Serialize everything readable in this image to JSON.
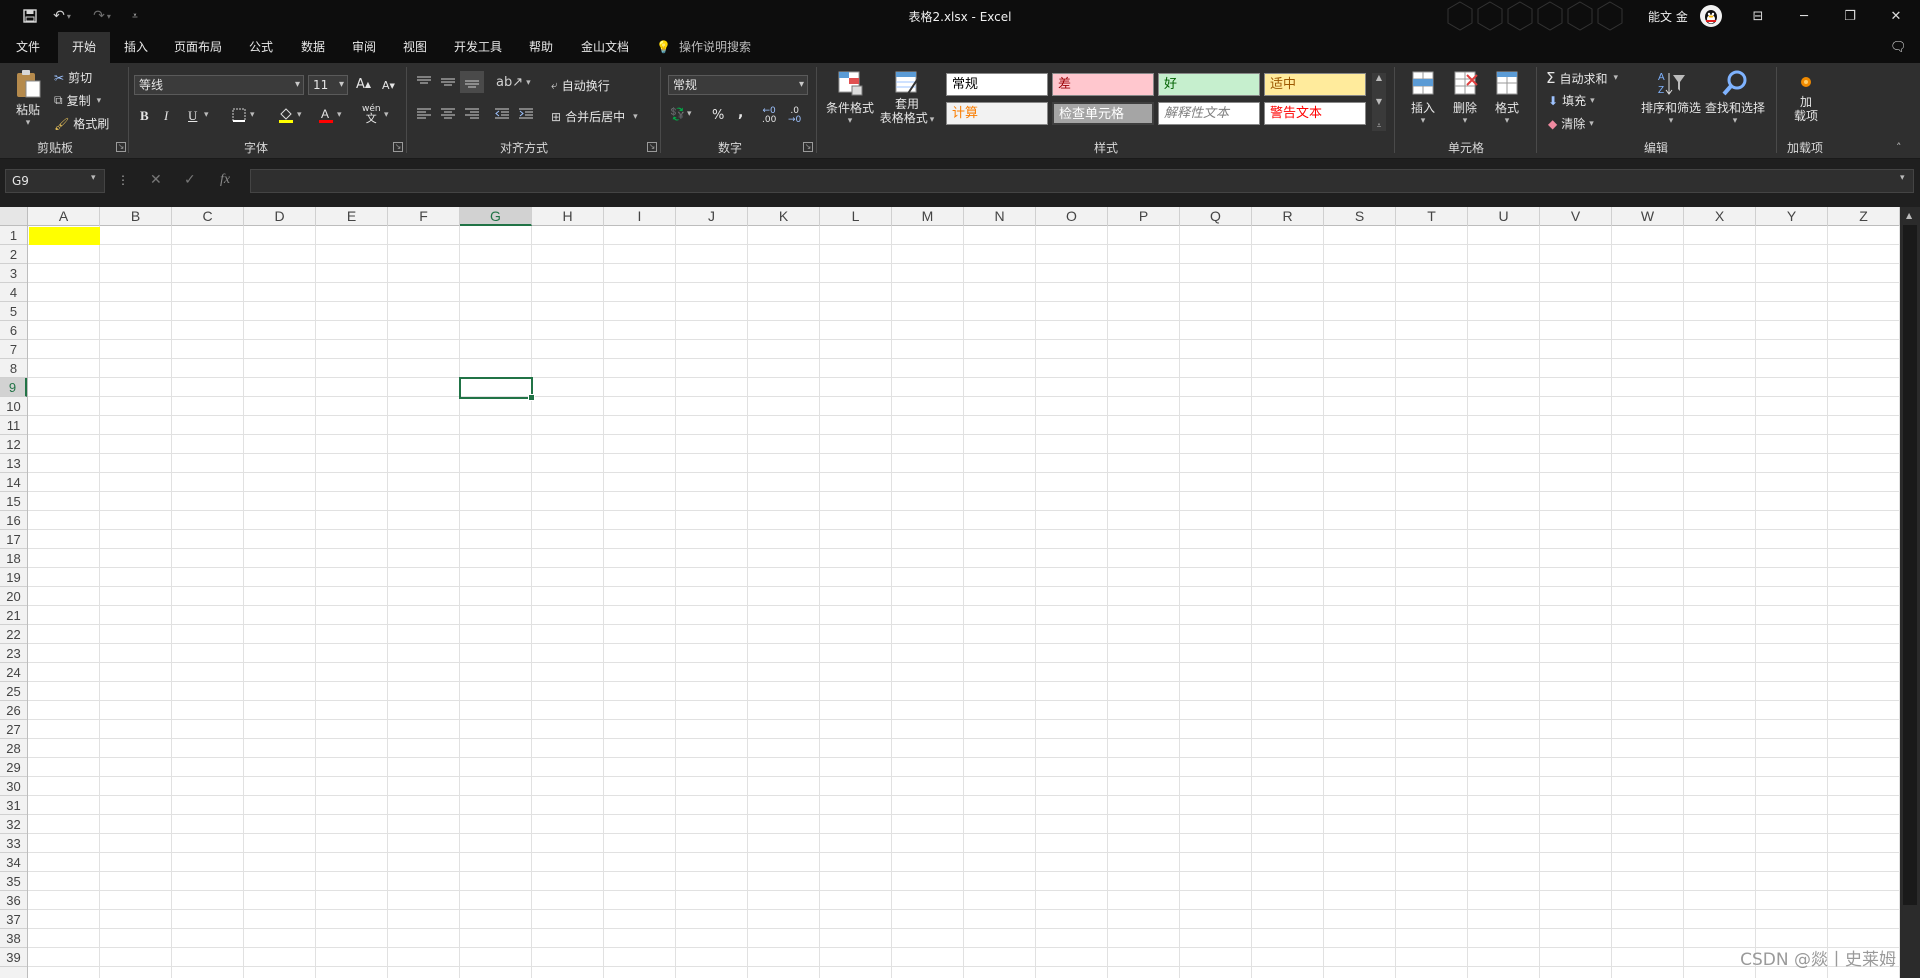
{
  "window": {
    "title": "表格2.xlsx  -  Excel",
    "user_name": "能文 金",
    "quick_access": [
      "save-icon",
      "undo-icon",
      "redo-icon",
      "customize-icon"
    ],
    "controls": [
      "ribbon-display-icon",
      "minimize-icon",
      "restore-icon",
      "close-icon"
    ]
  },
  "tabs": [
    {
      "label": "文件"
    },
    {
      "label": "开始"
    },
    {
      "label": "插入"
    },
    {
      "label": "页面布局"
    },
    {
      "label": "公式"
    },
    {
      "label": "数据"
    },
    {
      "label": "审阅"
    },
    {
      "label": "视图"
    },
    {
      "label": "开发工具"
    },
    {
      "label": "帮助"
    },
    {
      "label": "金山文档"
    }
  ],
  "active_tab": "开始",
  "tell_me": "操作说明搜索",
  "ribbon": {
    "clipboard": {
      "paste": "粘贴",
      "cut": "剪切",
      "copy": "复制",
      "format_painter": "格式刷",
      "label": "剪贴板"
    },
    "font": {
      "name": "等线",
      "size": "11",
      "bold": "B",
      "italic": "I",
      "underline": "U",
      "label": "字体",
      "wen": "wén",
      "grow": "A",
      "shrink": "A"
    },
    "alignment": {
      "wrap": "自动换行",
      "merge": "合并后居中",
      "label": "对齐方式"
    },
    "number": {
      "format": "常规",
      "percent": "%",
      "comma": ",",
      "inc": ".00",
      "dec": ".0",
      "label": "数字"
    },
    "styles": {
      "conditional": "条件格式",
      "table_line1": "套用",
      "table_line2": "表格格式",
      "cells": [
        {
          "label": "常规",
          "bg": "#ffffff",
          "fg": "#000000"
        },
        {
          "label": "差",
          "bg": "#ffc7ce",
          "fg": "#9c0006"
        },
        {
          "label": "好",
          "bg": "#c6efce",
          "fg": "#006100"
        },
        {
          "label": "适中",
          "bg": "#ffeb9c",
          "fg": "#9c5700"
        },
        {
          "label": "计算",
          "bg": "#f2f2f2",
          "fg": "#fa7d00"
        },
        {
          "label": "检查单元格",
          "bg": "#a5a5a5",
          "fg": "#ffffff"
        },
        {
          "label": "解释性文本",
          "bg": "#ffffff",
          "fg": "#7f7f7f"
        },
        {
          "label": "警告文本",
          "bg": "#ffffff",
          "fg": "#ff0000"
        }
      ],
      "label": "样式"
    },
    "cells": {
      "insert": "插入",
      "delete": "删除",
      "format": "格式",
      "label": "单元格"
    },
    "editing": {
      "autosum": "自动求和",
      "fill": "填充",
      "clear": "清除",
      "sort": "排序和筛选",
      "find": "查找和选择",
      "label": "编辑"
    },
    "addins": {
      "line1": "加",
      "line2": "载项",
      "label": "加载项"
    }
  },
  "formula_bar": {
    "name_box": "G9",
    "fx": "fx",
    "value": ""
  },
  "sheet": {
    "columns": [
      "A",
      "B",
      "C",
      "D",
      "E",
      "F",
      "G",
      "H",
      "I",
      "J",
      "K",
      "L",
      "M",
      "N",
      "O",
      "P",
      "Q",
      "R",
      "S",
      "T",
      "U",
      "V",
      "W",
      "X",
      "Y",
      "Z"
    ],
    "rows": [
      "1",
      "2",
      "3",
      "4",
      "5",
      "6",
      "7",
      "8",
      "9",
      "10",
      "11",
      "12",
      "13",
      "14",
      "15",
      "16",
      "17",
      "18",
      "19",
      "20",
      "21",
      "22",
      "23",
      "24",
      "25",
      "26",
      "27",
      "28",
      "29",
      "30",
      "31",
      "32",
      "33",
      "34",
      "35",
      "36",
      "37",
      "38",
      "39"
    ],
    "selected_cell": "G9",
    "highlighted_cell": {
      "ref": "A1",
      "fill": "#ffff00"
    }
  },
  "watermark": "CSDN @燚丨史莱姆"
}
